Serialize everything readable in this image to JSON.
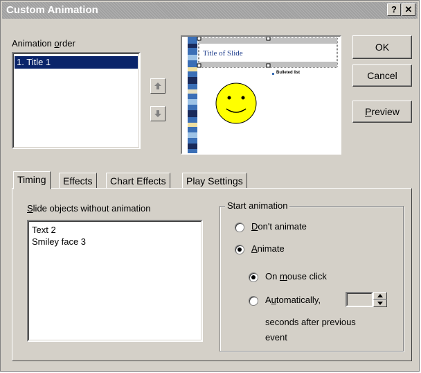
{
  "window": {
    "title": "Custom Animation",
    "help_glyph": "?",
    "close_glyph": "✕"
  },
  "animation_order": {
    "label_pre": "Animation ",
    "label_key": "o",
    "label_post": "rder",
    "items": [
      {
        "label": "1. Title 1",
        "selected": true
      }
    ]
  },
  "preview": {
    "slide_title": "Title of Slide",
    "bullet_text": "Bulleted list"
  },
  "buttons": {
    "ok": "OK",
    "cancel": "Cancel",
    "preview_key": "P",
    "preview_rest": "review"
  },
  "tabs": [
    {
      "label": "Timing",
      "active": true
    },
    {
      "label": "Effects",
      "active": false
    },
    {
      "label": "Chart Effects",
      "active": false
    },
    {
      "label": "Play Settings",
      "active": false
    }
  ],
  "timing": {
    "objects_label_key": "S",
    "objects_label_rest": "lide objects without animation",
    "objects": [
      "Text 2",
      "Smiley face 3"
    ],
    "start_group": "Start animation",
    "dont_animate_key": "D",
    "dont_animate_rest": "on't animate",
    "animate_key": "A",
    "animate_rest": "nimate",
    "on_click_pre": "On ",
    "on_click_key": "m",
    "on_click_post": "ouse click",
    "auto_pre": "A",
    "auto_key": "u",
    "auto_post": "tomatically,",
    "seconds_line1": "seconds after previous",
    "seconds_line2": "event",
    "selected_start": "animate",
    "selected_trigger": "on_mouse_click",
    "seconds_value": ""
  }
}
